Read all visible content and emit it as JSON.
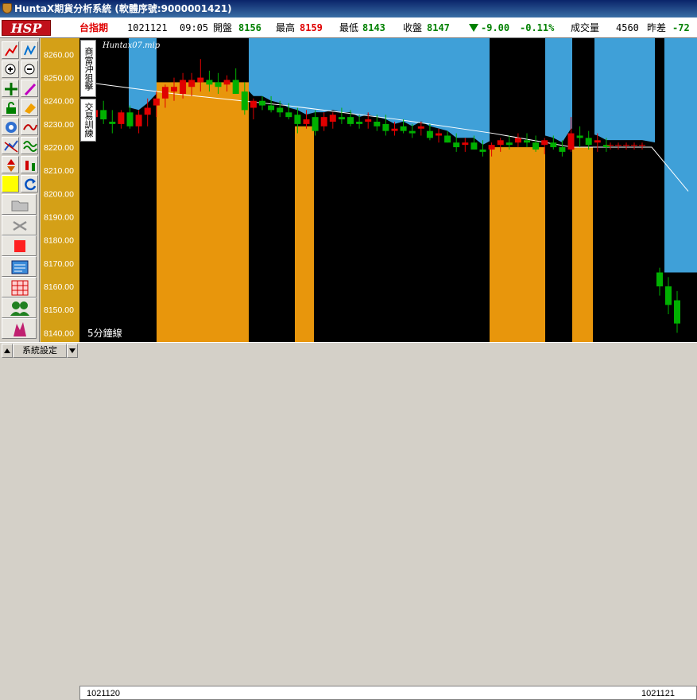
{
  "window": {
    "title": "HuntaX期貨分析系統 (軟體序號:9000001421)"
  },
  "toolbar": {
    "logo": "HSP",
    "market": "台指期",
    "date": "1021121",
    "time": "09:05",
    "open_label": "開盤",
    "open": "8156",
    "high_label": "最高",
    "high": "8159",
    "low_label": "最低",
    "low": "8143",
    "close_label": "收盤",
    "close": "8147",
    "change": "-9.00",
    "change_pct": "-0.11%",
    "volume_label": "成交量",
    "volume": "4560",
    "diff_label": "昨差",
    "diff": "-72"
  },
  "side_tabs": [
    "商當沖狙擊",
    "交易訓練"
  ],
  "chart_meta": {
    "file": "Huntax07.mip",
    "period": "5分鐘線"
  },
  "bottom": {
    "settings_label": "系統設定",
    "start_date": "1021120",
    "end_date": "1021121"
  },
  "colors": {
    "up": "#e00000",
    "down": "#00b000",
    "band_blue": "#3fa0d8",
    "band_orange": "#e8960c",
    "axis_bg": "#d4a017"
  },
  "chart_data": {
    "type": "candlestick",
    "ylim": [
      8136,
      8267
    ],
    "yticks": [
      "8260.00",
      "8250.00",
      "8240.00",
      "8230.00",
      "8220.00",
      "8210.00",
      "8200.00",
      "8190.00",
      "8180.00",
      "8170.00",
      "8160.00",
      "8150.00",
      "8140.00"
    ],
    "candles": [
      [
        8238,
        8241,
        8228,
        8232
      ],
      [
        8233,
        8238,
        8228,
        8236
      ],
      [
        8236,
        8240,
        8230,
        8232
      ],
      [
        8231,
        8236,
        8226,
        8230
      ],
      [
        8230,
        8236,
        8228,
        8235
      ],
      [
        8235,
        8238,
        8228,
        8229
      ],
      [
        8229,
        8236,
        8226,
        8234
      ],
      [
        8234,
        8241,
        8229,
        8237
      ],
      [
        8238,
        8244,
        8233,
        8241
      ],
      [
        8241,
        8247,
        8237,
        8246
      ],
      [
        8244,
        8250,
        8240,
        8246
      ],
      [
        8243,
        8252,
        8241,
        8249
      ],
      [
        8246,
        8252,
        8242,
        8249
      ],
      [
        8248,
        8258,
        8244,
        8250
      ],
      [
        8249,
        8253,
        8244,
        8247
      ],
      [
        8248,
        8252,
        8243,
        8246
      ],
      [
        8247,
        8251,
        8244,
        8249
      ],
      [
        8249,
        8254,
        8243,
        8243
      ],
      [
        8244,
        8248,
        8234,
        8236
      ],
      [
        8237,
        8241,
        8232,
        8240
      ],
      [
        8240,
        8242,
        8236,
        8238
      ],
      [
        8238,
        8242,
        8235,
        8236
      ],
      [
        8237,
        8240,
        8233,
        8235
      ],
      [
        8235,
        8239,
        8232,
        8233
      ],
      [
        8234,
        8237,
        8226,
        8230
      ],
      [
        8230,
        8236,
        8228,
        8232
      ],
      [
        8233,
        8236,
        8225,
        8227
      ],
      [
        8229,
        8235,
        8227,
        8233
      ],
      [
        8231,
        8235,
        8228,
        8234
      ],
      [
        8233,
        8237,
        8230,
        8232
      ],
      [
        8233,
        8236,
        8229,
        8230
      ],
      [
        8231,
        8234,
        8228,
        8230
      ],
      [
        8231,
        8235,
        8228,
        8232
      ],
      [
        8231,
        8234,
        8227,
        8229
      ],
      [
        8230,
        8234,
        8225,
        8227
      ],
      [
        8227,
        8231,
        8225,
        8228
      ],
      [
        8229,
        8232,
        8226,
        8227
      ],
      [
        8227,
        8230,
        8224,
        8226
      ],
      [
        8228,
        8231,
        8225,
        8229
      ],
      [
        8227,
        8230,
        8223,
        8224
      ],
      [
        8225,
        8228,
        8222,
        8226
      ],
      [
        8225,
        8227,
        8222,
        8222
      ],
      [
        8222,
        8226,
        8218,
        8220
      ],
      [
        8221,
        8224,
        8218,
        8222
      ],
      [
        8222,
        8225,
        8219,
        8219
      ],
      [
        8219,
        8223,
        8216,
        8218
      ],
      [
        8219,
        8222,
        8216,
        8221
      ],
      [
        8221,
        8224,
        8218,
        8223
      ],
      [
        8222,
        8225,
        8219,
        8221
      ],
      [
        8222,
        8226,
        8220,
        8224
      ],
      [
        8223,
        8226,
        8220,
        8222
      ],
      [
        8222,
        8225,
        8218,
        8219
      ],
      [
        8221,
        8224,
        8217,
        8223
      ],
      [
        8222,
        8225,
        8219,
        8220
      ],
      [
        8220,
        8223,
        8216,
        8218
      ],
      [
        8219,
        8233,
        8218,
        8226
      ],
      [
        8225,
        8229,
        8220,
        8224
      ],
      [
        8224,
        8227,
        8219,
        8221
      ],
      [
        8222,
        8226,
        8218,
        8223
      ],
      [
        8221,
        8224,
        8218,
        8220
      ],
      [
        8221,
        8222,
        8219,
        8221
      ],
      [
        8221,
        8222,
        8219,
        8221
      ],
      [
        8221,
        8222,
        8219,
        8221
      ],
      [
        8221,
        8222,
        8219,
        8221
      ],
      [
        8221,
        8222,
        8219,
        8221
      ],
      [
        8166,
        8168,
        8156,
        8160
      ],
      [
        8160,
        8164,
        8148,
        8152
      ],
      [
        8154,
        8158,
        8140,
        8144
      ]
    ],
    "ma": [
      8248,
      8243,
      8238,
      8232,
      8226,
      8220,
      8220,
      8201
    ]
  }
}
